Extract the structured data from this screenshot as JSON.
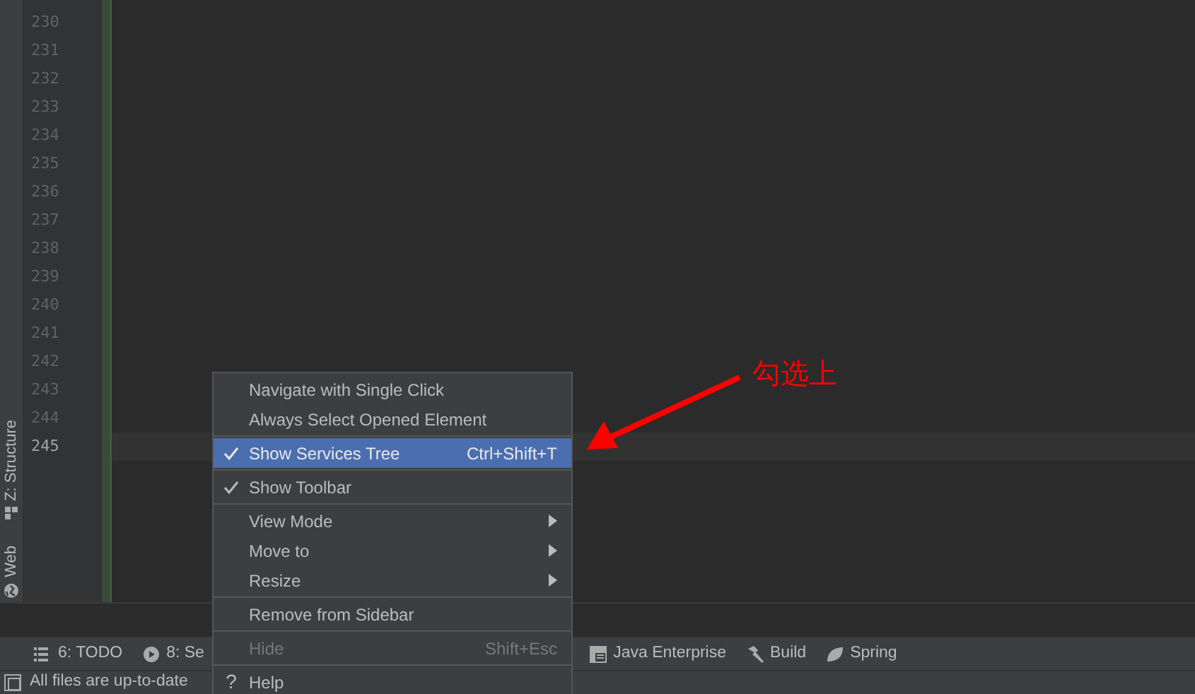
{
  "side_tabs": [
    {
      "label": "Z: Structure",
      "kind": "structure"
    },
    {
      "label": "Web",
      "kind": "web"
    }
  ],
  "editor": {
    "lines": [
      {
        "number": "230",
        "current": false
      },
      {
        "number": "231",
        "current": false
      },
      {
        "number": "232",
        "current": false
      },
      {
        "number": "233",
        "current": false
      },
      {
        "number": "234",
        "current": false
      },
      {
        "number": "235",
        "current": false
      },
      {
        "number": "236",
        "current": false
      },
      {
        "number": "237",
        "current": false
      },
      {
        "number": "238",
        "current": false
      },
      {
        "number": "239",
        "current": false
      },
      {
        "number": "240",
        "current": false
      },
      {
        "number": "241",
        "current": false
      },
      {
        "number": "242",
        "current": false
      },
      {
        "number": "243",
        "current": false
      },
      {
        "number": "244",
        "current": false
      },
      {
        "number": "245",
        "current": true
      }
    ]
  },
  "context_menu": {
    "items": [
      {
        "kind": "item",
        "label": "Navigate with Single Click",
        "checked": false,
        "selected": false,
        "disabled": false
      },
      {
        "kind": "item",
        "label": "Always Select Opened Element",
        "checked": false,
        "selected": false,
        "disabled": false
      },
      {
        "kind": "separator"
      },
      {
        "kind": "item",
        "label": "Show Services Tree",
        "shortcut": "Ctrl+Shift+T",
        "checked": true,
        "selected": true,
        "disabled": false
      },
      {
        "kind": "separator"
      },
      {
        "kind": "item",
        "label": "Show Toolbar",
        "checked": true,
        "selected": false,
        "disabled": false
      },
      {
        "kind": "separator"
      },
      {
        "kind": "submenu",
        "label": "View Mode",
        "checked": false,
        "selected": false,
        "disabled": false
      },
      {
        "kind": "submenu",
        "label": "Move to",
        "checked": false,
        "selected": false,
        "disabled": false
      },
      {
        "kind": "submenu",
        "label": "Resize",
        "checked": false,
        "selected": false,
        "disabled": false
      },
      {
        "kind": "separator"
      },
      {
        "kind": "item",
        "label": "Remove from Sidebar",
        "checked": false,
        "selected": false,
        "disabled": false
      },
      {
        "kind": "separator"
      },
      {
        "kind": "item",
        "label": "Hide",
        "shortcut": "Shift+Esc",
        "checked": false,
        "selected": false,
        "disabled": true
      },
      {
        "kind": "separator"
      },
      {
        "kind": "help",
        "label": "Help",
        "icon_text": "?",
        "selected": false,
        "disabled": false
      }
    ]
  },
  "tool_tabs": [
    {
      "label": "6: TODO",
      "kind": "todo"
    },
    {
      "label": "8: Se",
      "kind": "services"
    },
    {
      "label": "Java Enterprise",
      "kind": "javaee"
    },
    {
      "label": "Build",
      "kind": "build"
    },
    {
      "label": "Spring",
      "kind": "spring"
    }
  ],
  "status_bar": {
    "text": "All files are up-to-date"
  },
  "annotation": {
    "text": "勾选上"
  }
}
